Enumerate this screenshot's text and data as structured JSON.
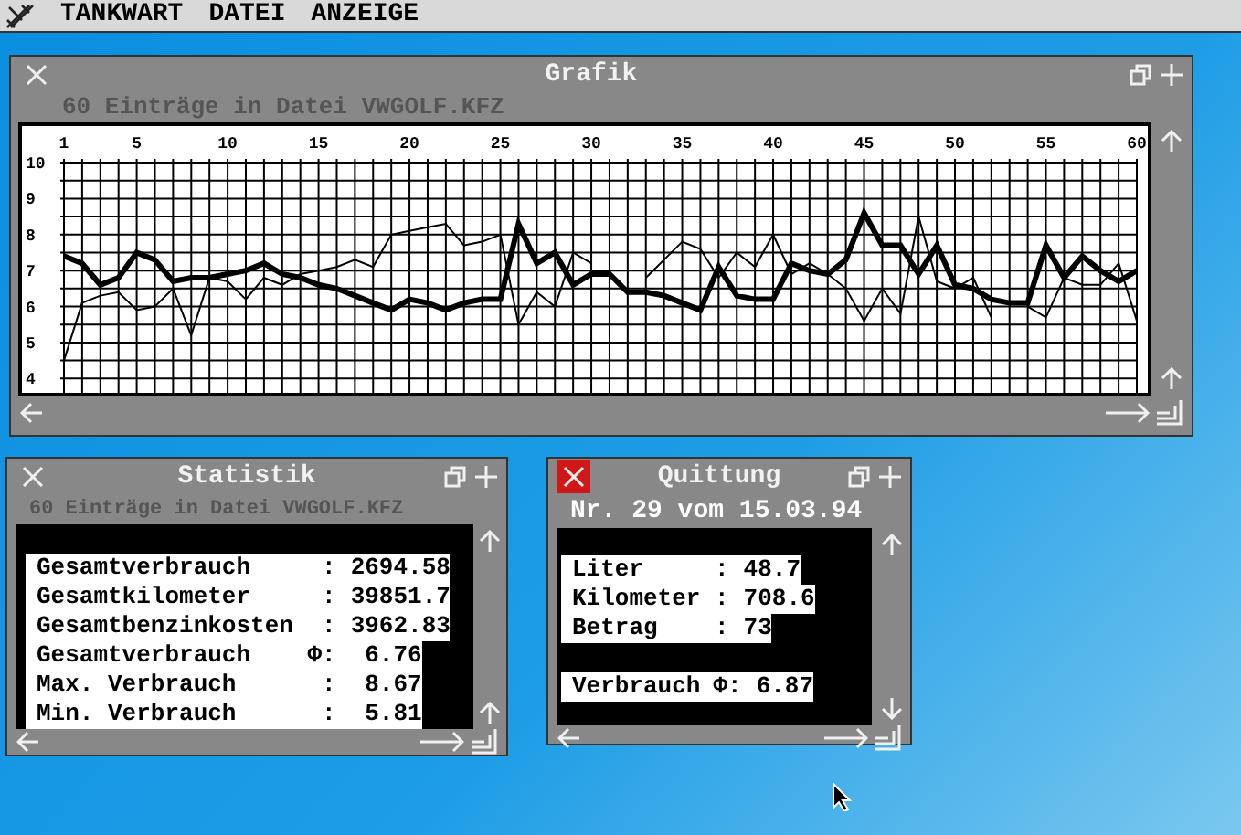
{
  "menu_bar": {
    "items": [
      {
        "label": "TANKWART"
      },
      {
        "label": "DATEI"
      },
      {
        "label": "ANZEIGE"
      }
    ]
  },
  "grafik_window": {
    "title": "Grafik",
    "active": false,
    "info": "60 Einträge in Datei VWGOLF.KFZ",
    "chart_data": {
      "type": "line",
      "x": [
        1,
        2,
        3,
        4,
        5,
        6,
        7,
        8,
        9,
        10,
        11,
        12,
        13,
        14,
        15,
        16,
        17,
        18,
        19,
        20,
        21,
        22,
        23,
        24,
        25,
        26,
        27,
        28,
        29,
        30,
        31,
        32,
        33,
        34,
        35,
        36,
        37,
        38,
        39,
        40,
        41,
        42,
        43,
        44,
        45,
        46,
        47,
        48,
        49,
        50,
        51,
        52,
        53,
        54,
        55,
        56,
        57,
        58,
        59,
        60
      ],
      "xlim": [
        1,
        60
      ],
      "ylim": [
        3.6,
        10
      ],
      "grid": true,
      "xticks": [
        1,
        5,
        10,
        15,
        20,
        25,
        30,
        35,
        40,
        45,
        50,
        55,
        60
      ],
      "yticks": [
        4,
        5,
        6,
        7,
        8,
        9,
        10
      ],
      "series": [
        {
          "color": "#000000",
          "values": [
            7.4,
            7.2,
            6.6,
            6.8,
            7.5,
            7.3,
            6.7,
            6.8,
            6.8,
            6.9,
            7.0,
            7.2,
            6.9,
            6.8,
            6.6,
            6.5,
            6.3,
            6.1,
            5.9,
            6.2,
            6.1,
            5.9,
            6.1,
            6.2,
            6.2,
            8.3,
            7.2,
            7.5,
            6.6,
            6.9,
            6.9,
            6.4,
            6.4,
            6.3,
            6.1,
            5.9,
            7.1,
            6.3,
            6.2,
            6.2,
            7.2,
            7.0,
            6.9,
            7.3,
            8.6,
            7.7,
            7.7,
            6.9,
            7.7,
            6.6,
            6.5,
            6.2,
            6.1,
            6.1,
            7.7,
            6.8,
            7.4,
            7.0,
            6.7,
            7.0
          ]
        },
        {
          "color": "#000000",
          "values": [
            4.5,
            6.1,
            6.3,
            6.4,
            5.9,
            6.0,
            6.5,
            5.2,
            6.8,
            6.7,
            6.2,
            6.8,
            6.6,
            6.9,
            7.0,
            7.1,
            7.3,
            7.1,
            8.0,
            8.1,
            8.2,
            8.3,
            7.7,
            7.8,
            8.0,
            5.5,
            6.4,
            6.0,
            7.5,
            7.2,
            null,
            null,
            6.8,
            7.3,
            7.8,
            7.6,
            6.8,
            7.5,
            7.1,
            8.0,
            6.9,
            7.2,
            6.9,
            6.5,
            5.6,
            6.5,
            5.8,
            8.5,
            6.7,
            6.5,
            6.8,
            5.7,
            null,
            6.0,
            5.7,
            6.8,
            6.6,
            6.6,
            7.2,
            5.6
          ]
        }
      ]
    }
  },
  "statistik_window": {
    "title": "Statistik",
    "active": false,
    "info": "60 Einträge in Datei VWGOLF.KFZ",
    "rows": [
      {
        "label": "Gesamtverbrauch",
        "separator": ":",
        "value": "2694.58"
      },
      {
        "label": "Gesamtkilometer",
        "separator": ":",
        "value": "39851.7"
      },
      {
        "label": "Gesamtbenzinkosten",
        "separator": ":",
        "value": "3962.83"
      },
      {
        "label": "Gesamtverbrauch",
        "separator": "Φ:",
        "value": "6.76"
      },
      {
        "label": "Max. Verbrauch",
        "separator": ":",
        "value": "8.67"
      },
      {
        "label": "Min. Verbrauch",
        "separator": ":",
        "value": "5.81"
      }
    ]
  },
  "quittung_window": {
    "title": "Quittung",
    "active": true,
    "subtitle": "Nr. 29 vom 15.03.94",
    "rows": [
      {
        "label": "Liter",
        "separator": ":",
        "value": "48.7"
      },
      {
        "label": "Kilometer",
        "separator": ":",
        "value": "708.6"
      },
      {
        "label": "Betrag",
        "separator": ":",
        "value": "73"
      }
    ],
    "summary": {
      "label": "Verbrauch",
      "separator": "Φ:",
      "value": "6.87"
    }
  }
}
